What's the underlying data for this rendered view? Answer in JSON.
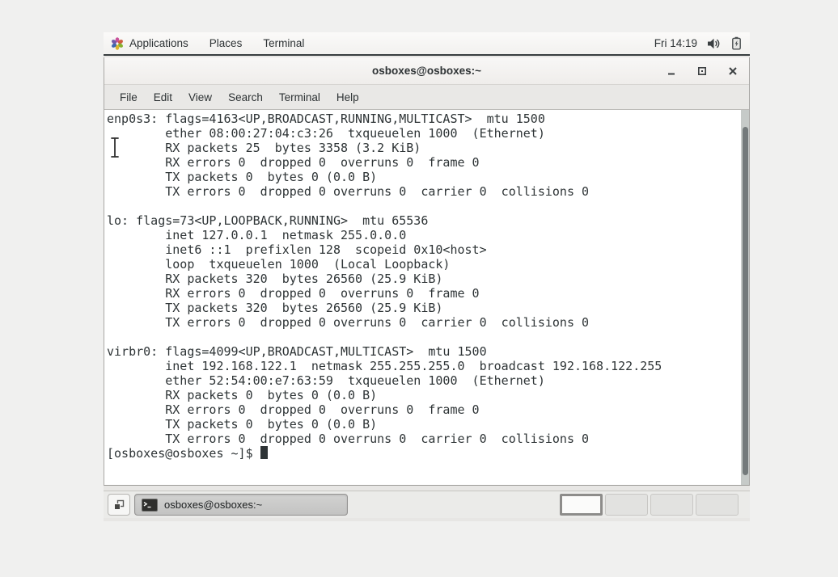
{
  "top_bar": {
    "app_menu": "Applications",
    "places_menu": "Places",
    "terminal_menu": "Terminal",
    "clock": "Fri 14:19"
  },
  "window": {
    "title": "osboxes@osboxes:~",
    "menus": [
      "File",
      "Edit",
      "View",
      "Search",
      "Terminal",
      "Help"
    ],
    "terminal": {
      "lines": [
        "enp0s3: flags=4163<UP,BROADCAST,RUNNING,MULTICAST>  mtu 1500",
        "        ether 08:00:27:04:c3:26  txqueuelen 1000  (Ethernet)",
        "        RX packets 25  bytes 3358 (3.2 KiB)",
        "        RX errors 0  dropped 0  overruns 0  frame 0",
        "        TX packets 0  bytes 0 (0.0 B)",
        "        TX errors 0  dropped 0 overruns 0  carrier 0  collisions 0",
        "",
        "lo: flags=73<UP,LOOPBACK,RUNNING>  mtu 65536",
        "        inet 127.0.0.1  netmask 255.0.0.0",
        "        inet6 ::1  prefixlen 128  scopeid 0x10<host>",
        "        loop  txqueuelen 1000  (Local Loopback)",
        "        RX packets 320  bytes 26560 (25.9 KiB)",
        "        RX errors 0  dropped 0  overruns 0  frame 0",
        "        TX packets 320  bytes 26560 (25.9 KiB)",
        "        TX errors 0  dropped 0 overruns 0  carrier 0  collisions 0",
        "",
        "virbr0: flags=4099<UP,BROADCAST,MULTICAST>  mtu 1500",
        "        inet 192.168.122.1  netmask 255.255.255.0  broadcast 192.168.122.255",
        "        ether 52:54:00:e7:63:59  txqueuelen 1000  (Ethernet)",
        "        RX packets 0  bytes 0 (0.0 B)",
        "        RX errors 0  dropped 0  overruns 0  frame 0",
        "        TX packets 0  bytes 0 (0.0 B)",
        "        TX errors 0  dropped 0 overruns 0  carrier 0  collisions 0",
        ""
      ],
      "prompt": "[osboxes@osboxes ~]$ "
    }
  },
  "taskbar": {
    "task_button_label": "osboxes@osboxes:~",
    "workspace_count": "4"
  },
  "colors": {
    "terminal_fg": "#2e3436",
    "terminal_bg": "#ffffff",
    "panel_border": "#383d3f",
    "scroll_thumb": "#747a7b"
  }
}
